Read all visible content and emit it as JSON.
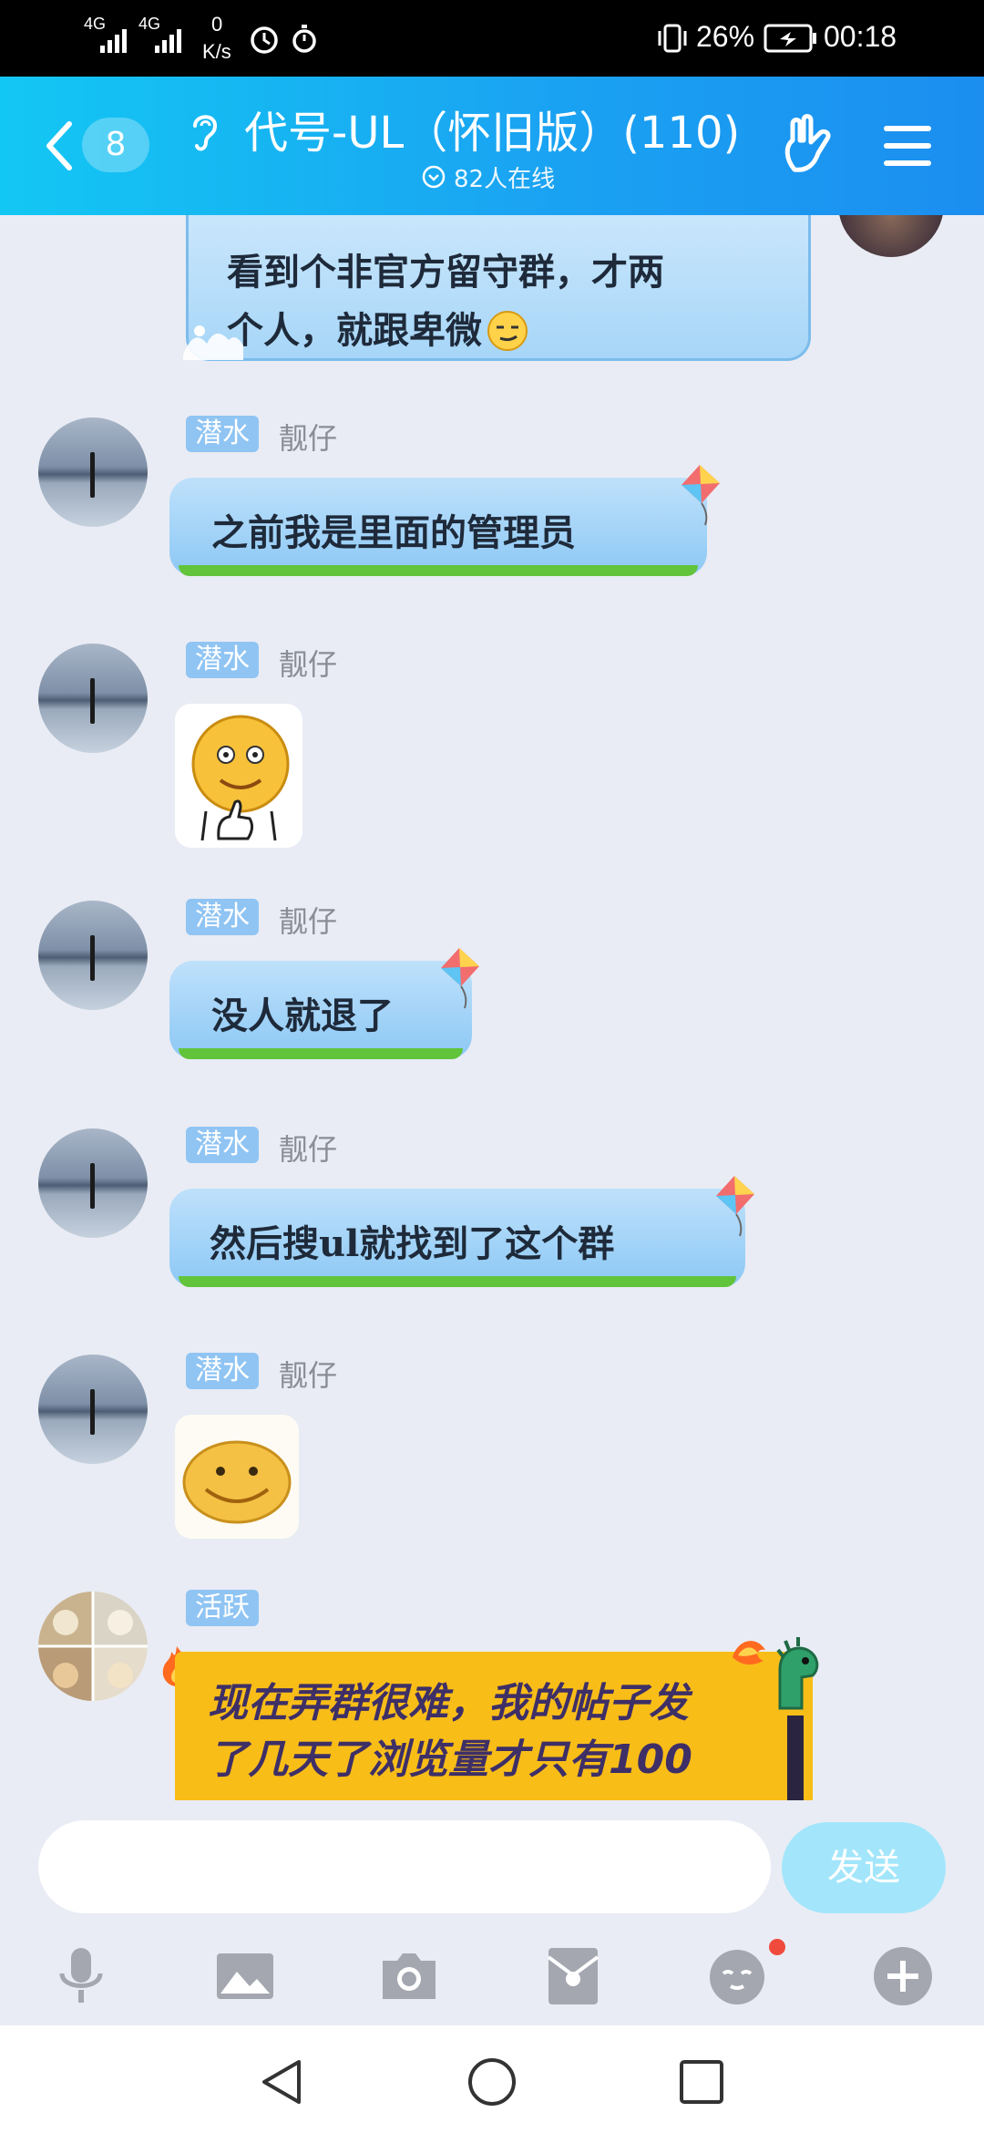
{
  "status_bar": {
    "signal1": "4G",
    "signal2": "4G",
    "speed_value": "0",
    "speed_unit": "K/s",
    "battery": "26%",
    "time": "00:18"
  },
  "header": {
    "back_count": "8",
    "title": "代号-UL（怀旧版）(110)",
    "online": "82人在线"
  },
  "messages": [
    {
      "type": "text",
      "text_line1": "看到个非官方留守群，才两",
      "text_line2": "个人，就跟卑微"
    },
    {
      "type": "text",
      "badge": "潜水",
      "nick": "靓仔",
      "text": "之前我是里面的管理员"
    },
    {
      "type": "sticker",
      "badge": "潜水",
      "nick": "靓仔"
    },
    {
      "type": "text",
      "badge": "潜水",
      "nick": "靓仔",
      "text": "没人就退了"
    },
    {
      "type": "text",
      "badge": "潜水",
      "nick": "靓仔",
      "text": "然后搜ul就找到了这个群"
    },
    {
      "type": "sticker",
      "badge": "潜水",
      "nick": "靓仔"
    },
    {
      "type": "text",
      "badge": "活跃",
      "text_line1": "现在弄群很难，我的帖子发",
      "text_line2": "了几天了浏览量才只有100"
    }
  ],
  "input": {
    "send_label": "发送"
  },
  "toolbar": [
    "microphone-icon",
    "image-icon",
    "camera-icon",
    "red-packet-icon",
    "emoji-icon",
    "plus-icon"
  ],
  "colors": {
    "header_start": "#13c7f3",
    "header_end": "#1b8ef0",
    "badge": "#8fc4f3",
    "send": "#a3e6fb",
    "notify_dot": "#f04a3c"
  }
}
